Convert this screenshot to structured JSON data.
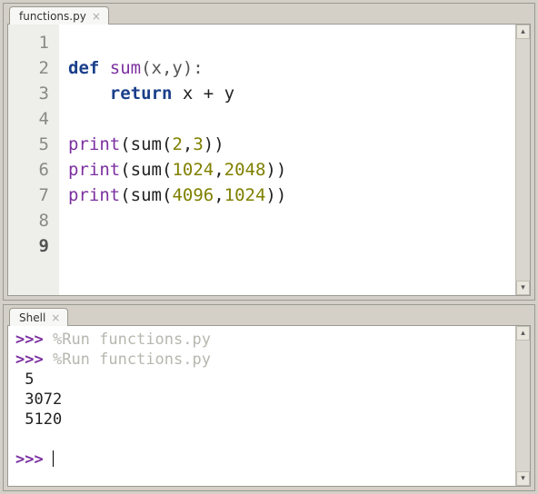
{
  "editor": {
    "tab_label": "functions.py",
    "line_numbers": [
      "1",
      "2",
      "3",
      "4",
      "5",
      "6",
      "7",
      "8",
      "9"
    ],
    "current_line": 9,
    "code": {
      "l1": "",
      "l2": {
        "kw_def": "def",
        "fn": "sum",
        "params": "(x,y):"
      },
      "l3": {
        "kw_return": "return",
        "expr": "x + y"
      },
      "l4": "",
      "l5": {
        "fn": "print",
        "call": "sum",
        "a": "2",
        "b": "3"
      },
      "l6": {
        "fn": "print",
        "call": "sum",
        "a": "1024",
        "b": "2048"
      },
      "l7": {
        "fn": "print",
        "call": "sum",
        "a": "4096",
        "b": "1024"
      },
      "l8": "",
      "l9": ""
    }
  },
  "shell": {
    "tab_label": "Shell",
    "prompt": ">>>",
    "run1": "%Run functions.py",
    "run2": "%Run functions.py",
    "out1": "5",
    "out2": "3072",
    "out3": "5120"
  }
}
